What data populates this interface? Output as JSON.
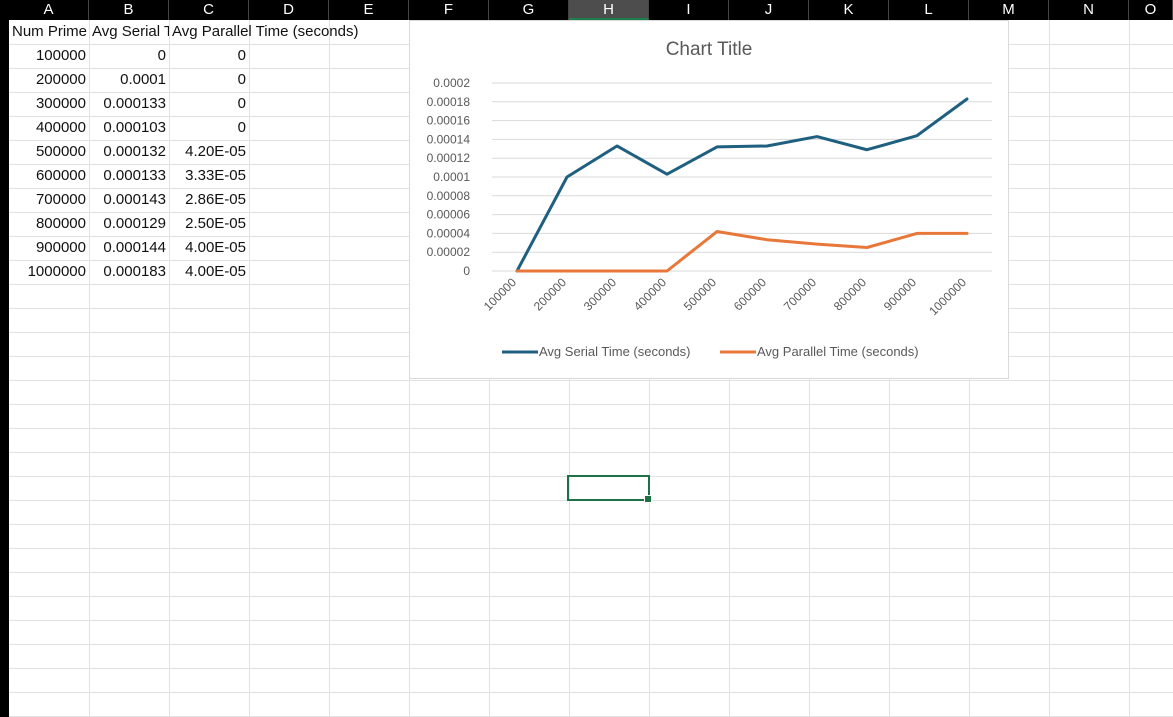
{
  "sheet": {
    "columns": [
      "A",
      "B",
      "C",
      "D",
      "E",
      "F",
      "G",
      "H",
      "I",
      "J",
      "K",
      "L",
      "M",
      "N",
      "O"
    ],
    "selected_column": "H",
    "header_row": [
      "Num Prime",
      "Avg Serial Time (seconds)",
      "Avg Parallel Time (seconds)"
    ],
    "rows": [
      [
        "100000",
        "0",
        "0"
      ],
      [
        "200000",
        "0.0001",
        "0"
      ],
      [
        "300000",
        "0.000133",
        "0"
      ],
      [
        "400000",
        "0.000103",
        "0"
      ],
      [
        "500000",
        "0.000132",
        "4.20E-05"
      ],
      [
        "600000",
        "0.000133",
        "3.33E-05"
      ],
      [
        "700000",
        "0.000143",
        "2.86E-05"
      ],
      [
        "800000",
        "0.000129",
        "2.50E-05"
      ],
      [
        "900000",
        "0.000144",
        "4.00E-05"
      ],
      [
        "1000000",
        "0.000183",
        "4.00E-05"
      ]
    ],
    "active_cell": "H20"
  },
  "chart_data": {
    "type": "line",
    "title": "Chart Title",
    "categories": [
      "100000",
      "200000",
      "300000",
      "400000",
      "500000",
      "600000",
      "700000",
      "800000",
      "900000",
      "1000000"
    ],
    "series": [
      {
        "name": "Avg Serial Time (seconds)",
        "color": "#1f5f7f",
        "values": [
          0,
          0.0001,
          0.000133,
          0.000103,
          0.000132,
          0.000133,
          0.000143,
          0.000129,
          0.000144,
          0.000183
        ]
      },
      {
        "name": "Avg Parallel Time (seconds)",
        "color": "#e8773a",
        "values": [
          0,
          0,
          0,
          0,
          4.2e-05,
          3.33e-05,
          2.86e-05,
          2.5e-05,
          4e-05,
          4e-05
        ]
      }
    ],
    "y_ticks": [
      "0",
      "0.00002",
      "0.00004",
      "0.00006",
      "0.00008",
      "0.0001",
      "0.00012",
      "0.00014",
      "0.00016",
      "0.00018",
      "0.0002"
    ],
    "ylim": [
      0,
      0.0002
    ],
    "grid": true,
    "legend_position": "bottom"
  }
}
